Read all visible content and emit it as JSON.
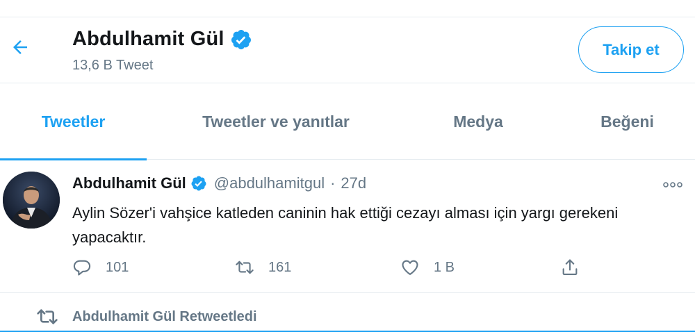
{
  "header": {
    "name": "Abdulhamit Gül",
    "tweet_count": "13,6 B Tweet",
    "follow_label": "Takip et"
  },
  "tabs": [
    {
      "label": "Tweetler",
      "active": true
    },
    {
      "label": "Tweetler ve yanıtlar",
      "active": false
    },
    {
      "label": "Medya",
      "active": false
    },
    {
      "label": "Beğeni",
      "active": false
    }
  ],
  "tweet": {
    "author": "Abdulhamit Gül",
    "handle": "@abdulhamitgul",
    "separator": "·",
    "time": "27d",
    "text": "Aylin Sözer'i vahşice katleden caninin hak ettiği cezayı alması için yargı gerekeni yapacaktır.",
    "replies": "101",
    "retweets": "161",
    "likes": "1 B"
  },
  "retweeted_label": "Abdulhamit Gül Retweetledi",
  "icons": {
    "back": "back-arrow-icon",
    "verified": "verified-badge-icon",
    "more": "more-icon",
    "reply": "reply-icon",
    "retweet": "retweet-icon",
    "like": "heart-icon",
    "share": "share-icon"
  },
  "colors": {
    "accent": "#1da1f2",
    "text": "#14171a",
    "secondary": "#657786",
    "divider": "#e6ecf0"
  }
}
